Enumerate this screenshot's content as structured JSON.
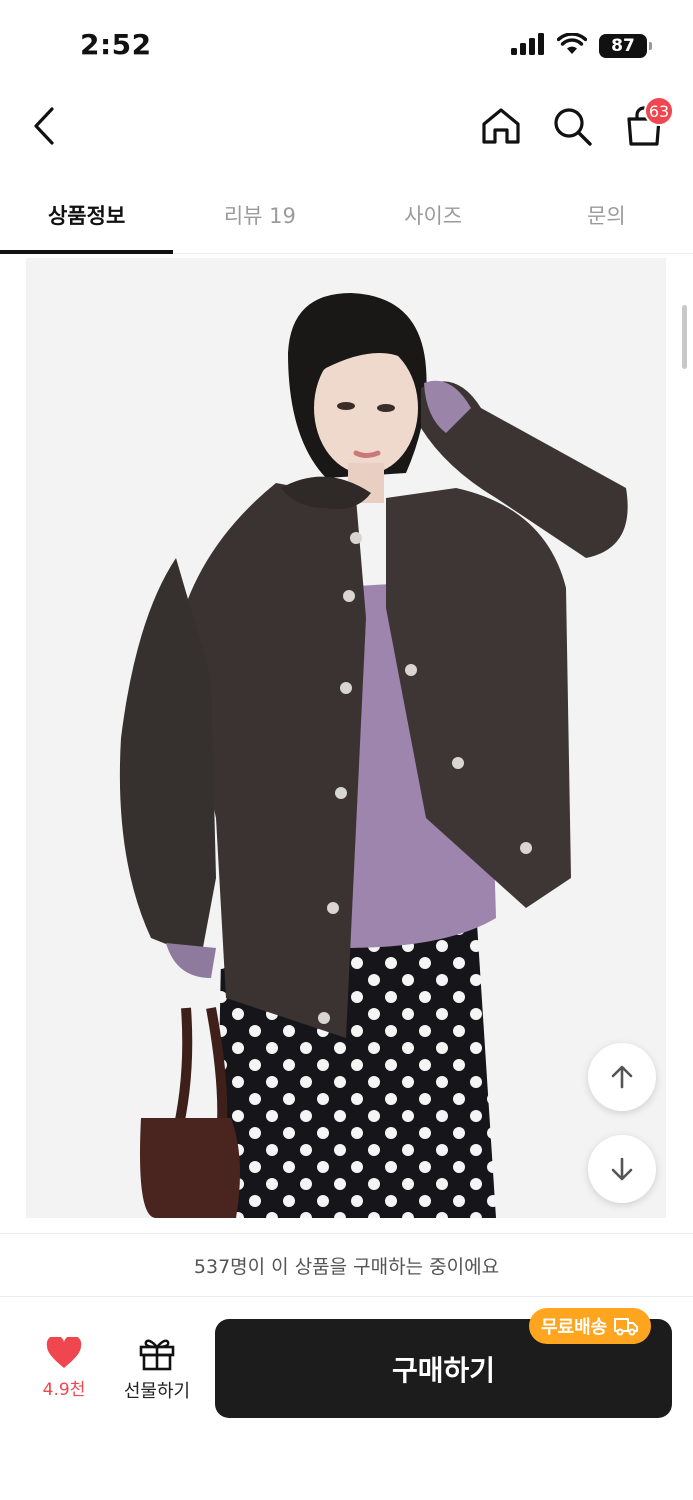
{
  "status_bar": {
    "time": "2:52",
    "battery": "87"
  },
  "nav": {
    "cart_count": "63"
  },
  "tabs": [
    {
      "label": "상품정보",
      "active": true
    },
    {
      "label": "리뷰 19",
      "active": false
    },
    {
      "label": "사이즈",
      "active": false
    },
    {
      "label": "문의",
      "active": false
    }
  ],
  "product_image": {
    "alt": "dark brown snap-button jacket, lavender top, black polka dot skirt"
  },
  "notice": {
    "text": "537명이 이 상품을 구매하는 중이에요"
  },
  "bottom": {
    "like_count": "4.9천",
    "gift_label": "선물하기",
    "buy_label": "구매하기",
    "free_shipping_label": "무료배송"
  },
  "colors": {
    "accent_red": "#f0464f",
    "badge_orange": "#ffa51f",
    "buy_bg": "#1c1c1c"
  }
}
